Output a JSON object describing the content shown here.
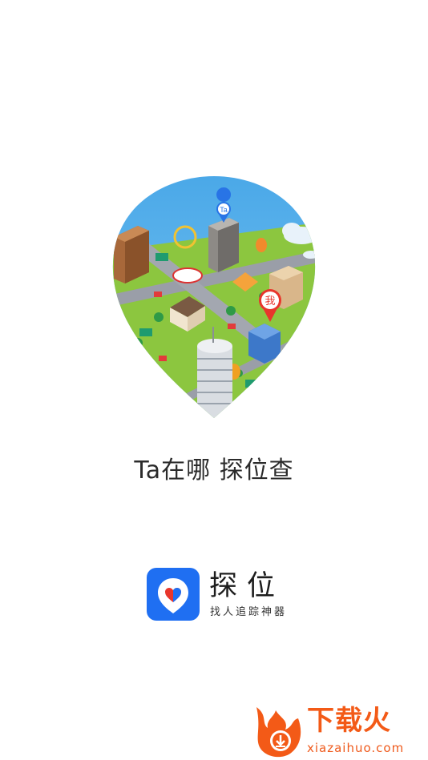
{
  "splash": {
    "tagline": "Ta在哪 探位查",
    "app_name": "探位",
    "app_slogan": "找人追踪神器",
    "map_pins": {
      "target_label": "Ta",
      "me_label": "我"
    }
  },
  "watermark": {
    "brand": "下载火",
    "domain": "xiazaihuo.com"
  },
  "colors": {
    "sky": "#58b4ec",
    "ground": "#8cc63f",
    "logo_blue": "#1f6ff2",
    "pin_red": "#e8362c",
    "watermark": "#f35a17"
  }
}
